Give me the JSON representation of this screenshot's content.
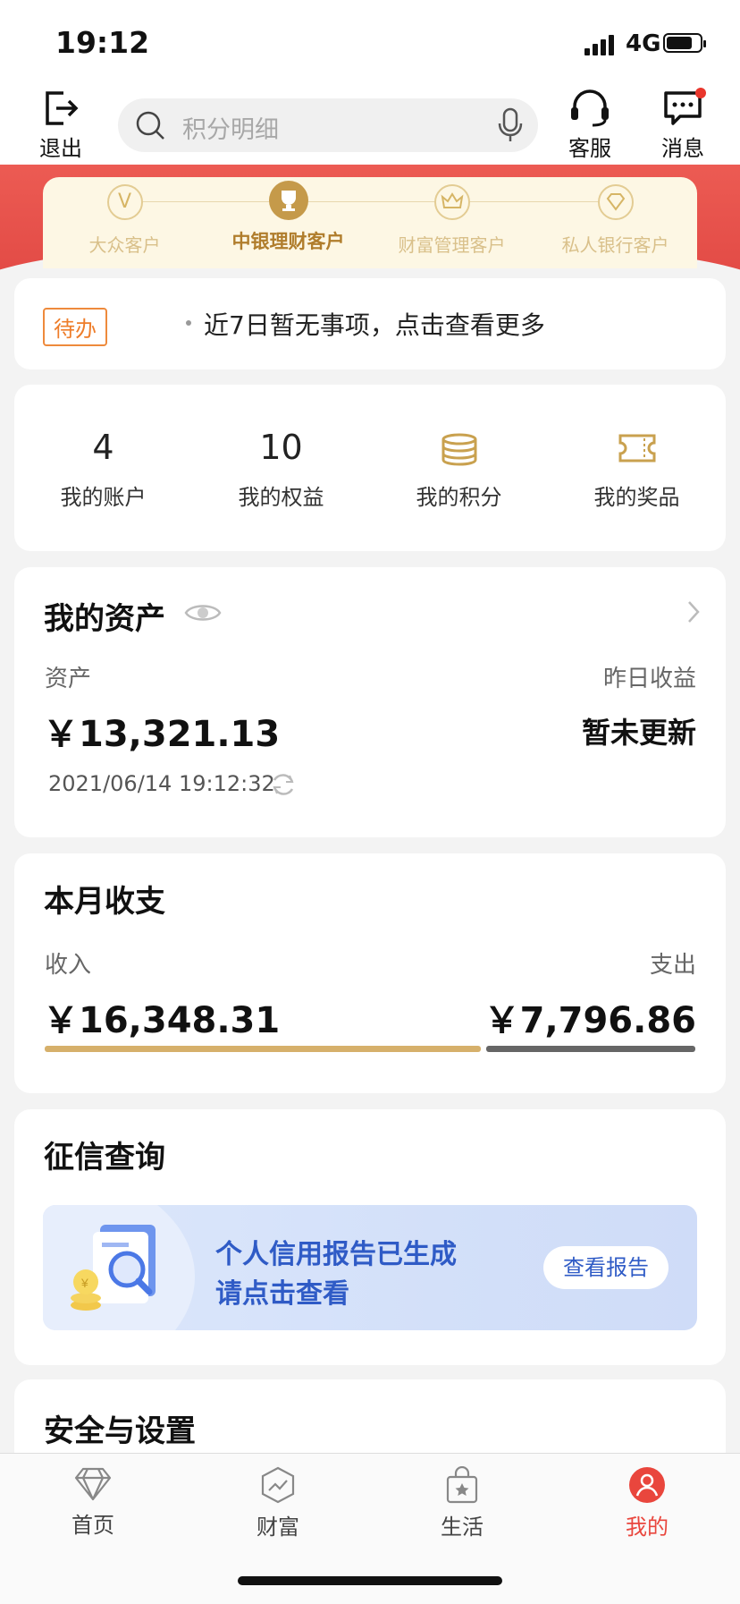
{
  "status_bar": {
    "time": "19:12",
    "network": "4G"
  },
  "header": {
    "logout_label": "退出",
    "search_placeholder": "积分明细",
    "service_label": "客服",
    "message_label": "消息"
  },
  "levels": [
    {
      "label": "大众客户",
      "glyph": "V",
      "active": false
    },
    {
      "label": "中银理财客户",
      "glyph": "",
      "active": true
    },
    {
      "label": "财富管理客户",
      "glyph": "",
      "active": false
    },
    {
      "label": "私人银行客户",
      "glyph": "",
      "active": false
    }
  ],
  "todo": {
    "badge": "待办",
    "text": "近7日暂无事项，点击查看更多"
  },
  "stats": [
    {
      "value": "4",
      "label": "我的账户"
    },
    {
      "value": "10",
      "label": "我的权益"
    },
    {
      "icon": "coins-icon",
      "label": "我的积分"
    },
    {
      "icon": "ticket-icon",
      "label": "我的奖品"
    }
  ],
  "assets": {
    "title": "我的资产",
    "asset_label": "资产",
    "asset_value": "￥13,321.13",
    "yesterday_label": "昨日收益",
    "yesterday_value": "暂未更新",
    "timestamp": "2021/06/14 19:12:32"
  },
  "month": {
    "title": "本月收支",
    "income_label": "收入",
    "income_value": "￥16,348.31",
    "expense_label": "支出",
    "expense_value": "￥7,796.86",
    "income_share": 0.676
  },
  "credit": {
    "title": "征信查询",
    "line1": "个人信用报告已生成",
    "line2": "请点击查看",
    "button": "查看报告"
  },
  "security": {
    "title": "安全与设置"
  },
  "tabbar": [
    {
      "label": "首页",
      "icon": "diamond-icon",
      "active": false
    },
    {
      "label": "财富",
      "icon": "chart-icon",
      "active": false
    },
    {
      "label": "生活",
      "icon": "bag-icon",
      "active": false
    },
    {
      "label": "我的",
      "icon": "user-icon",
      "active": true
    }
  ],
  "colors": {
    "brand_red": "#e9463d",
    "gold": "#d6b06b",
    "credit_blue": "#2f5bc6"
  }
}
